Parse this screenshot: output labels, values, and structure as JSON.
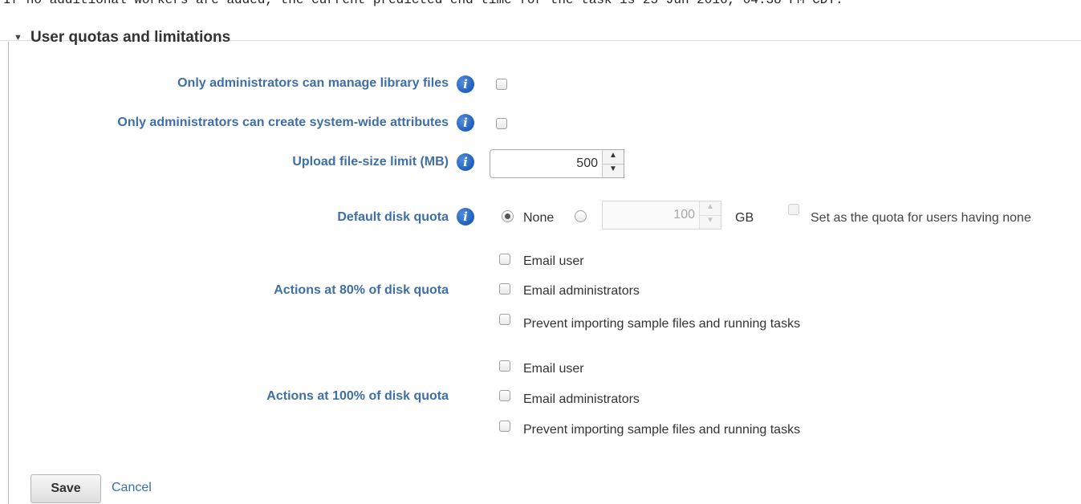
{
  "clipped_banner": "If no additional workers are added, the current predicted end time for the task is 25 Jun 2016, 04:38 PM CDT.",
  "section": {
    "title": "User quotas and limitations",
    "expanded": true
  },
  "settings": {
    "manage_library": {
      "label": "Only administrators can manage library files",
      "checked": false
    },
    "system_attributes": {
      "label": "Only administrators can create system-wide attributes",
      "checked": false
    },
    "upload_limit": {
      "label": "Upload file-size limit (MB)",
      "value": "500"
    },
    "disk_quota": {
      "label": "Default disk quota",
      "none_label": "None",
      "selected": "None",
      "amount": "100",
      "unit": "GB",
      "apply_label": "Set as the quota for users having none"
    }
  },
  "actions_80": {
    "label": "Actions at 80% of disk quota",
    "options": [
      {
        "label": "Email user",
        "checked": false
      },
      {
        "label": "Email administrators",
        "checked": false
      },
      {
        "label": "Prevent importing sample files and running tasks",
        "checked": false
      }
    ]
  },
  "actions_100": {
    "label": "Actions at 100% of disk quota",
    "options": [
      {
        "label": "Email user",
        "checked": false
      },
      {
        "label": "Email administrators",
        "checked": false
      },
      {
        "label": "Prevent importing sample files and running tasks",
        "checked": false
      }
    ]
  },
  "buttons": {
    "save": "Save",
    "cancel": "Cancel"
  },
  "icons": {
    "info": "info-icon",
    "toggle": "triangle-down-icon"
  },
  "colors": {
    "label_blue": "#3f6fa6",
    "info_blue": "#1f5fb8"
  }
}
